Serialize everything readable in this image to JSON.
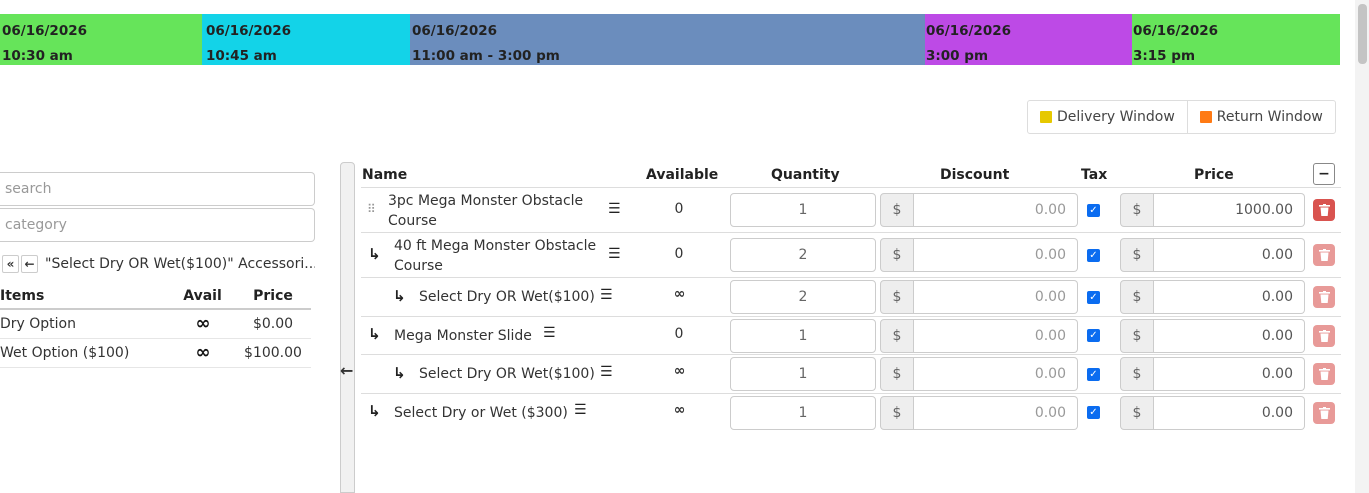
{
  "timeline": [
    {
      "date": "06/16/2026",
      "time": "10:30 am",
      "color": "#66e45a"
    },
    {
      "date": "06/16/2026",
      "time": "10:45 am",
      "color": "#13d3e8"
    },
    {
      "date": "06/16/2026",
      "time": "11:00 am - 3:00 pm",
      "color": "#6b8dbd"
    },
    {
      "date": "06/16/2026",
      "time": "3:00 pm",
      "color": "#bd4ae6"
    },
    {
      "date": "06/16/2026",
      "time": "3:15 pm",
      "color": "#66e45a"
    }
  ],
  "window_buttons": {
    "delivery": {
      "label": "Delivery Window",
      "color": "#e6c800"
    },
    "return": {
      "label": "Return Window",
      "color": "#ff7a14"
    }
  },
  "left_panel": {
    "search_placeholder": "search",
    "category_placeholder": "category",
    "nav": {
      "first_icon": "double-left-icon",
      "back_icon": "left-arrow-icon"
    },
    "accessory_title": "\"Select Dry OR Wet($100)\" Accessori...",
    "columns": {
      "items": "Items",
      "avail": "Avail",
      "price": "Price"
    },
    "items": [
      {
        "name": "Dry Option",
        "avail": "∞",
        "price": "$0.00"
      },
      {
        "name": "Wet Option ($100)",
        "avail": "∞",
        "price": "$100.00"
      }
    ]
  },
  "main_table": {
    "columns": {
      "name": "Name",
      "available": "Available",
      "quantity": "Quantity",
      "discount": "Discount",
      "tax": "Tax",
      "price": "Price"
    },
    "currency_symbol": "$",
    "rows": [
      {
        "name": "3pc Mega Monster Obstacle Course",
        "available": "0",
        "quantity": "1",
        "discount": "0.00",
        "price": "1000.00",
        "tax": true
      },
      {
        "name": "40 ft Mega Monster Obstacle Course",
        "available": "0",
        "quantity": "2",
        "discount": "0.00",
        "price": "0.00",
        "tax": true
      },
      {
        "name": "Select Dry OR Wet($100)",
        "available": "∞",
        "quantity": "2",
        "discount": "0.00",
        "price": "0.00",
        "tax": true
      },
      {
        "name": "Mega Monster Slide",
        "available": "0",
        "quantity": "1",
        "discount": "0.00",
        "price": "0.00",
        "tax": true
      },
      {
        "name": "Select Dry OR Wet($100)",
        "available": "∞",
        "quantity": "1",
        "discount": "0.00",
        "price": "0.00",
        "tax": true
      },
      {
        "name": "Select Dry or Wet ($300)",
        "available": "∞",
        "quantity": "1",
        "discount": "0.00",
        "price": "0.00",
        "tax": true
      }
    ]
  },
  "colors": {
    "delete_active": "#d9534f",
    "delete_muted": "#e89a98",
    "checkbox": "#0b6cf0"
  }
}
